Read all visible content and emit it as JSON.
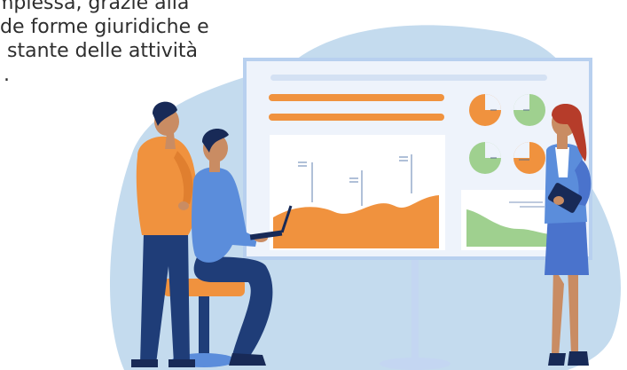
{
  "text": {
    "line1": "mplessa, grazie alla",
    "line2": "de forme giuridiche e",
    "line3": "stante delle attività",
    "line4": "."
  },
  "colors": {
    "background_blob": "#c4dbee",
    "board": "#eef3fb",
    "board_frame": "#b8d0ef",
    "orange": "#f0923e",
    "green": "#9fd08f",
    "blue_shirt": "#5b8ddb",
    "navy": "#1f3d78",
    "dark_navy": "#182a57",
    "skin": "#c98c63",
    "hair_red": "#b63c2a"
  }
}
